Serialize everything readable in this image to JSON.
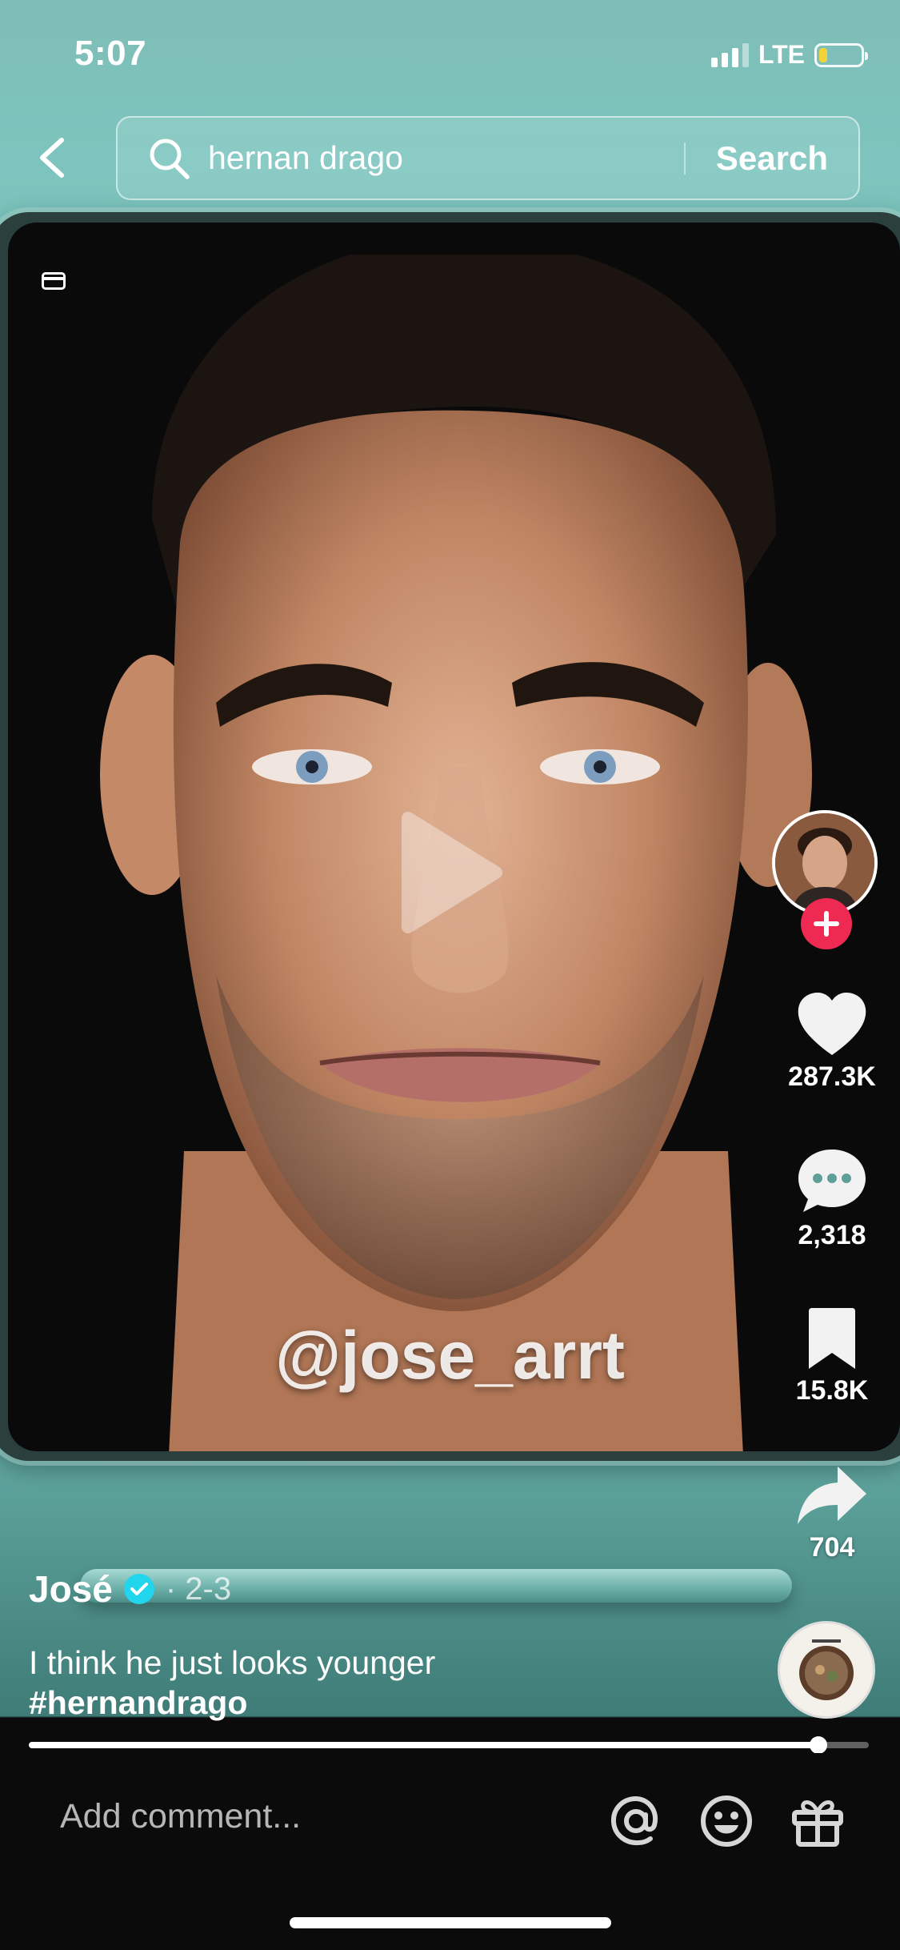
{
  "status_bar": {
    "time": "5:07",
    "network": "LTE",
    "signal_bars_filled": 3,
    "battery_level": 0.2,
    "battery_color": "#f3d33a"
  },
  "header": {
    "back_icon": "chevron-left-icon",
    "search_icon": "search-icon",
    "search_query": "hernan drago",
    "search_button": "Search"
  },
  "video": {
    "watermark": "@jose_arrt",
    "state": "paused",
    "progress": 0.94
  },
  "actions": {
    "follow_icon": "plus-icon",
    "likes": "287.3K",
    "comments": "2,318",
    "saves": "15.8K",
    "shares": "704",
    "follow_color": "#ee2a53"
  },
  "post": {
    "author": "José",
    "verified_color": "#20d5ec",
    "date": "· 2-3",
    "caption": "I think he just looks younger",
    "hashtag": "#hernandrago"
  },
  "comment_bar": {
    "placeholder": "Add comment...",
    "icons": [
      "mention-icon",
      "emoji-icon",
      "gift-icon"
    ]
  }
}
